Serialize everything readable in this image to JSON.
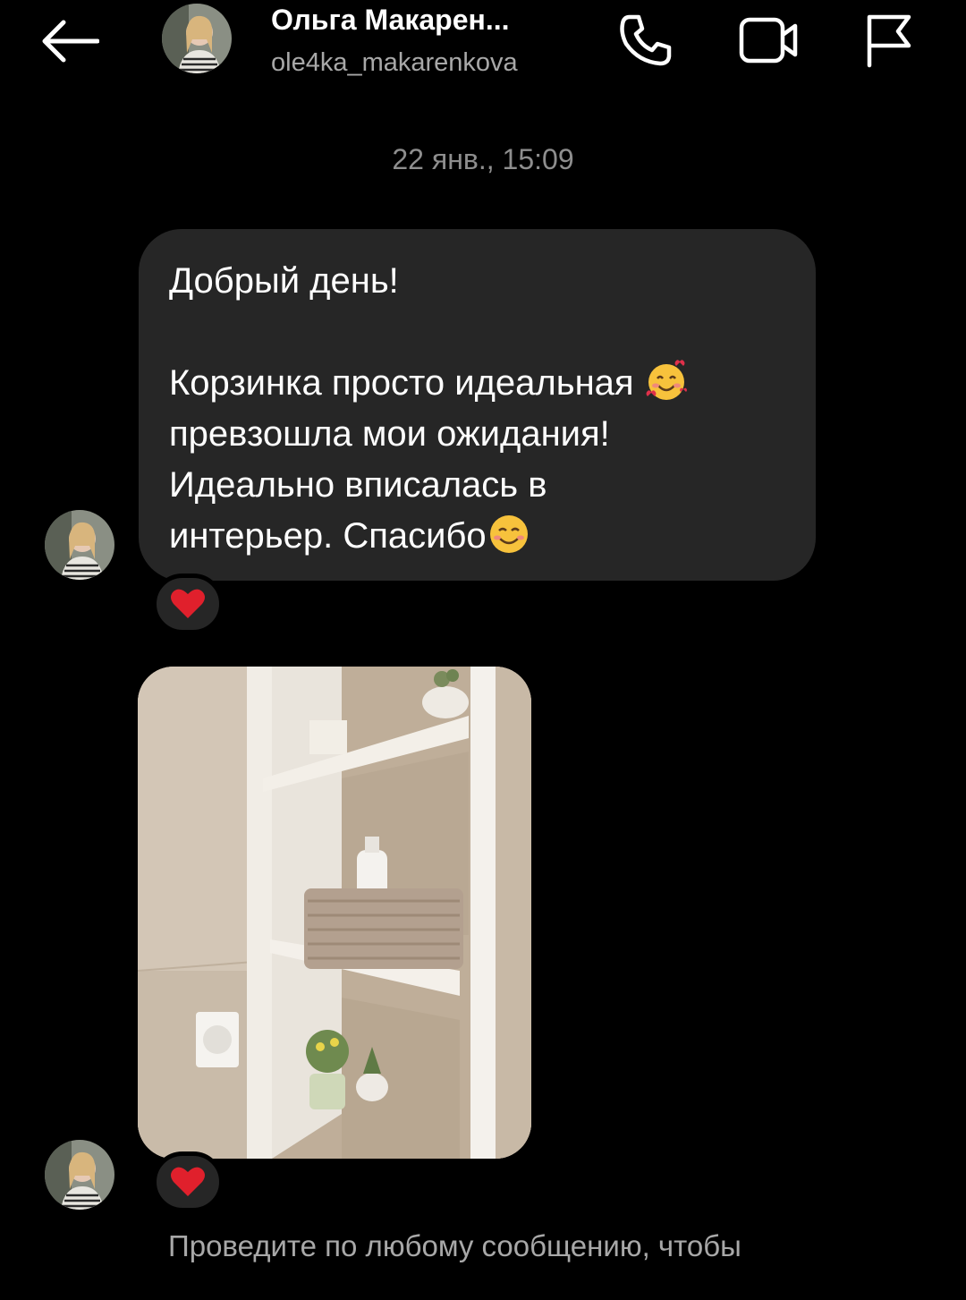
{
  "header": {
    "name": "Ольга Макарен...",
    "username": "ole4ka_makarenkova",
    "icons": [
      "back-arrow-icon",
      "phone-icon",
      "video-camera-icon",
      "flag-icon"
    ]
  },
  "thread": {
    "timestamp": "22 янв., 15:09",
    "message_text": "Добрый день!\n\nКорзинка просто идеальная \nпревзошла мои ожидания!\nИдеально вписалась в\nинтерьер. Спасибо",
    "emojis": [
      "smiling-face-with-hearts",
      "smiling-face"
    ],
    "reaction_1": "❤",
    "reaction_2": "❤",
    "photo_subject": "shelf-with-knitted-basket-photo"
  },
  "hint": {
    "text": "Проведите по любому сообщению, чтобы"
  },
  "colors": {
    "background": "#000000",
    "bubble": "#262626",
    "secondary_text": "#a8a8a8",
    "timestamp": "#8e8e8e",
    "heart": "#e0202c"
  }
}
